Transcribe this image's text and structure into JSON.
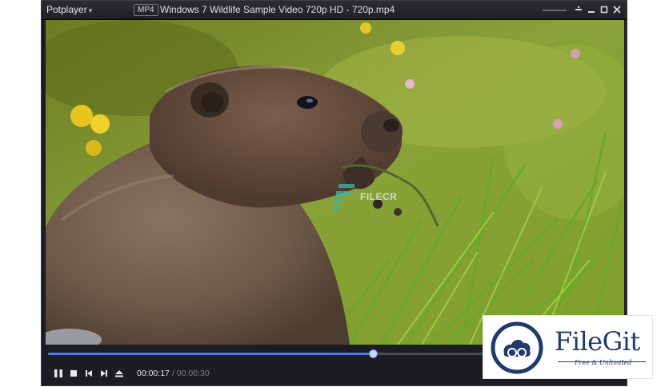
{
  "app": {
    "name": "Potplayer",
    "format_badge": "MP4",
    "file_title": "Windows 7 Wildlife Sample Video 720p HD - 720p.mp4"
  },
  "window_controls": [
    "pin",
    "minimize",
    "maximize",
    "close"
  ],
  "playback": {
    "current_time": "00:00:17",
    "total_time": "00:00:30",
    "progress": 0.567,
    "state": "playing"
  },
  "controls": {
    "buttons": [
      "pause-icon",
      "stop-icon",
      "previous-icon",
      "next-icon",
      "eject-icon"
    ]
  },
  "watermark": {
    "text": "FILECR"
  },
  "badge": {
    "name": "FileGit",
    "tagline": "Free & Unlimited"
  },
  "colors": {
    "accent": "#4a7be6",
    "brand": "#213a6b"
  }
}
